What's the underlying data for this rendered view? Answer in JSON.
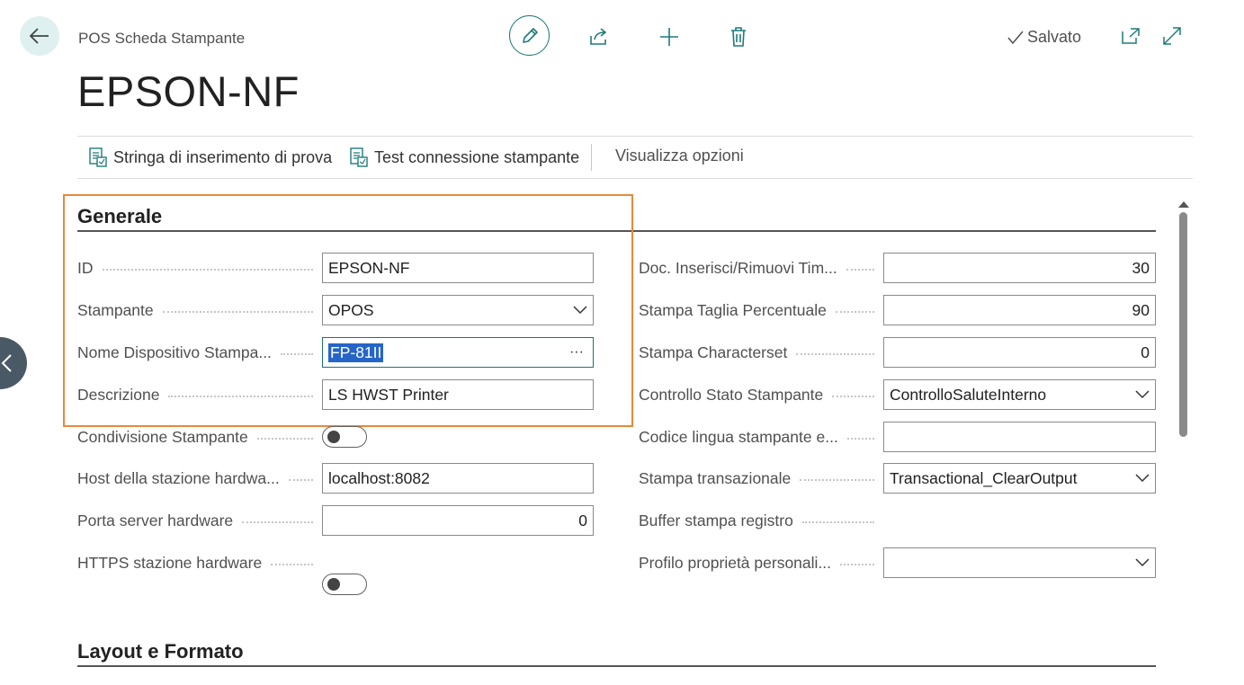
{
  "header": {
    "page_type": "POS Scheda Stampante",
    "title": "EPSON-NF",
    "saved_label": "Salvato"
  },
  "actions": [
    {
      "label": "Stringa di inserimento di prova"
    },
    {
      "label": "Test connessione stampante"
    },
    {
      "label": "Visualizza opzioni"
    }
  ],
  "sections": {
    "general": "Generale",
    "layout": "Layout e Formato"
  },
  "left_fields": [
    {
      "label": "ID",
      "value": "EPSON-NF",
      "type": "text"
    },
    {
      "label": "Stampante",
      "value": "OPOS",
      "type": "select"
    },
    {
      "label": "Nome Dispositivo Stampa...",
      "value": "FP-81II",
      "type": "lookup"
    },
    {
      "label": "Descrizione",
      "value": "LS HWST Printer",
      "type": "text"
    },
    {
      "label": "Condivisione Stampante",
      "value": "off",
      "type": "toggle"
    },
    {
      "label": "Host della stazione hardwa...",
      "value": "localhost:8082",
      "type": "text"
    },
    {
      "label": "Porta server hardware",
      "value": "0",
      "type": "number"
    },
    {
      "label": "HTTPS stazione hardware",
      "value": "off",
      "type": "toggle"
    }
  ],
  "right_fields": [
    {
      "label": "Doc. Inserisci/Rimuovi Tim...",
      "value": "30",
      "type": "number"
    },
    {
      "label": "Stampa Taglia Percentuale",
      "value": "90",
      "type": "number"
    },
    {
      "label": "Stampa Characterset",
      "value": "0",
      "type": "number"
    },
    {
      "label": "Controllo Stato Stampante",
      "value": "ControlloSaluteInterno",
      "type": "select"
    },
    {
      "label": "Codice lingua stampante e...",
      "value": "",
      "type": "text"
    },
    {
      "label": "Stampa transazionale",
      "value": "Transactional_ClearOutput",
      "type": "select"
    },
    {
      "label": "Buffer stampa registro",
      "value": "off",
      "type": "toggle"
    },
    {
      "label": "Profilo proprietà personali...",
      "value": "",
      "type": "select"
    }
  ],
  "lookup_ellipsis": "···",
  "icons": [
    "back-arrow-icon",
    "edit-pencil-icon",
    "share-icon",
    "add-icon",
    "delete-icon",
    "checkmark-icon",
    "open-new-window-icon",
    "expand-icon",
    "test-page-icon",
    "chevron-down-icon",
    "chevron-left-icon"
  ],
  "colors": {
    "accent": "#1f7a7a",
    "highlight_box": "#e8883a",
    "selection": "#2565c8"
  }
}
